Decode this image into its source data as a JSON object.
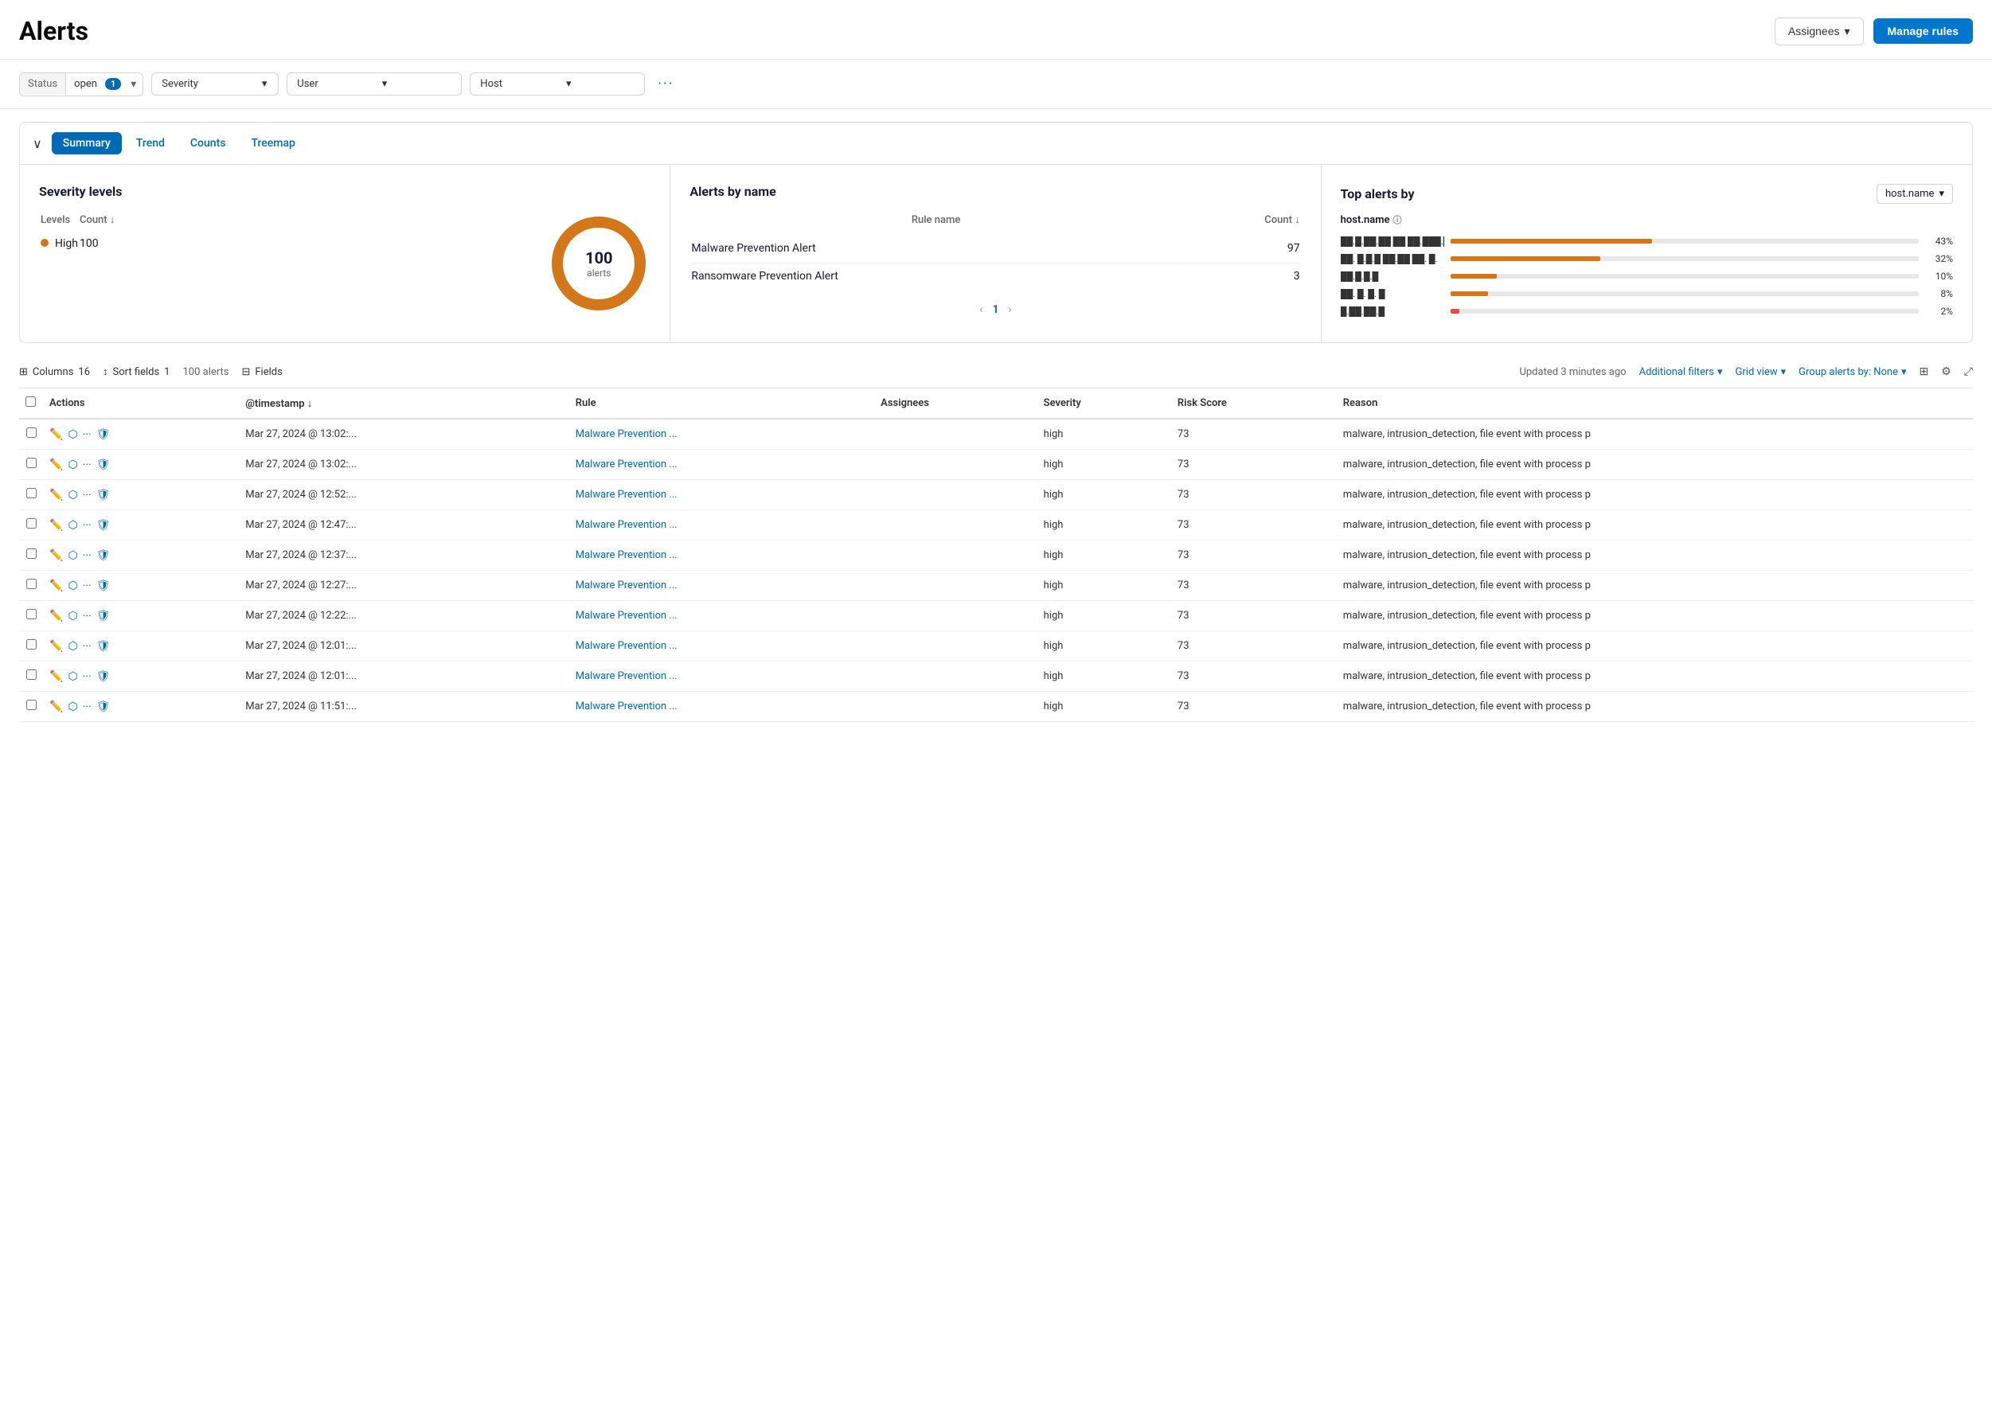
{
  "header": {
    "title": "Alerts",
    "assignees_label": "Assignees",
    "manage_rules_label": "Manage rules"
  },
  "filters": {
    "status_label": "Status",
    "status_value": "open",
    "status_badge": "1",
    "severity_label": "Severity",
    "user_label": "User",
    "host_label": "Host",
    "more_icon": "···"
  },
  "viz": {
    "collapse_icon": "∨",
    "tabs": [
      {
        "label": "Summary",
        "active": true
      },
      {
        "label": "Trend",
        "active": false
      },
      {
        "label": "Counts",
        "active": false
      },
      {
        "label": "Treemap",
        "active": false
      }
    ],
    "severity_panel": {
      "title": "Severity levels",
      "levels_col": "Levels",
      "count_col": "Count",
      "rows": [
        {
          "name": "High",
          "count": 100
        }
      ],
      "donut": {
        "total": 100,
        "label": "100",
        "sublabel": "alerts"
      }
    },
    "alerts_by_name_panel": {
      "title": "Alerts by name",
      "rule_col": "Rule name",
      "count_col": "Count",
      "rows": [
        {
          "name": "Malware Prevention Alert",
          "count": 97
        },
        {
          "name": "Ransomware Prevention Alert",
          "count": 3
        }
      ],
      "pagination": {
        "prev": "‹",
        "page": "1",
        "next": "›"
      }
    },
    "top_alerts_panel": {
      "title": "Top alerts by",
      "dropdown_value": "host.name",
      "field_label": "host.name",
      "bars": [
        {
          "label": "██.█.██.██ ██ ██.███.██",
          "pct": 43,
          "pct_label": "43%",
          "color": "orange"
        },
        {
          "label": "██. █.█.█ ██.██ ██. █.",
          "pct": 32,
          "pct_label": "32%",
          "color": "orange"
        },
        {
          "label": "██.█.█.█",
          "pct": 10,
          "pct_label": "10%",
          "color": "orange"
        },
        {
          "label": "██. █. █. █",
          "pct": 8,
          "pct_label": "8%",
          "color": "orange"
        },
        {
          "label": "█.██.██.█",
          "pct": 2,
          "pct_label": "2%",
          "color": "red"
        }
      ]
    }
  },
  "table": {
    "toolbar": {
      "columns_label": "Columns",
      "columns_count": "16",
      "sort_label": "Sort fields",
      "sort_count": "1",
      "alerts_count": "100 alerts",
      "fields_label": "Fields",
      "updated_text": "Updated 3 minutes ago",
      "additional_filters": "Additional filters",
      "grid_view": "Grid view",
      "group_alerts": "Group alerts by: None"
    },
    "columns": [
      {
        "label": "Actions"
      },
      {
        "label": "@timestamp ↓"
      },
      {
        "label": "Rule"
      },
      {
        "label": "Assignees"
      },
      {
        "label": "Severity"
      },
      {
        "label": "Risk Score"
      },
      {
        "label": "Reason"
      }
    ],
    "rows": [
      {
        "timestamp": "Mar 27, 2024 @ 13:02:...",
        "rule": "Malware Prevention ...",
        "assignees": "",
        "severity": "high",
        "risk_score": "73",
        "reason": "malware, intrusion_detection, file event with process p"
      },
      {
        "timestamp": "Mar 27, 2024 @ 13:02:...",
        "rule": "Malware Prevention ...",
        "assignees": "",
        "severity": "high",
        "risk_score": "73",
        "reason": "malware, intrusion_detection, file event with process p"
      },
      {
        "timestamp": "Mar 27, 2024 @ 12:52:...",
        "rule": "Malware Prevention ...",
        "assignees": "",
        "severity": "high",
        "risk_score": "73",
        "reason": "malware, intrusion_detection, file event with process p"
      },
      {
        "timestamp": "Mar 27, 2024 @ 12:47:...",
        "rule": "Malware Prevention ...",
        "assignees": "",
        "severity": "high",
        "risk_score": "73",
        "reason": "malware, intrusion_detection, file event with process p"
      },
      {
        "timestamp": "Mar 27, 2024 @ 12:37:...",
        "rule": "Malware Prevention ...",
        "assignees": "",
        "severity": "high",
        "risk_score": "73",
        "reason": "malware, intrusion_detection, file event with process p"
      },
      {
        "timestamp": "Mar 27, 2024 @ 12:27:...",
        "rule": "Malware Prevention ...",
        "assignees": "",
        "severity": "high",
        "risk_score": "73",
        "reason": "malware, intrusion_detection, file event with process p"
      },
      {
        "timestamp": "Mar 27, 2024 @ 12:22:...",
        "rule": "Malware Prevention ...",
        "assignees": "",
        "severity": "high",
        "risk_score": "73",
        "reason": "malware, intrusion_detection, file event with process p"
      },
      {
        "timestamp": "Mar 27, 2024 @ 12:01:...",
        "rule": "Malware Prevention ...",
        "assignees": "",
        "severity": "high",
        "risk_score": "73",
        "reason": "malware, intrusion_detection, file event with process p"
      },
      {
        "timestamp": "Mar 27, 2024 @ 12:01:...",
        "rule": "Malware Prevention ...",
        "assignees": "",
        "severity": "high",
        "risk_score": "73",
        "reason": "malware, intrusion_detection, file event with process p"
      },
      {
        "timestamp": "Mar 27, 2024 @ 11:51:...",
        "rule": "Malware Prevention ...",
        "assignees": "",
        "severity": "high",
        "risk_score": "73",
        "reason": "malware, intrusion_detection, file event with process p"
      }
    ]
  }
}
